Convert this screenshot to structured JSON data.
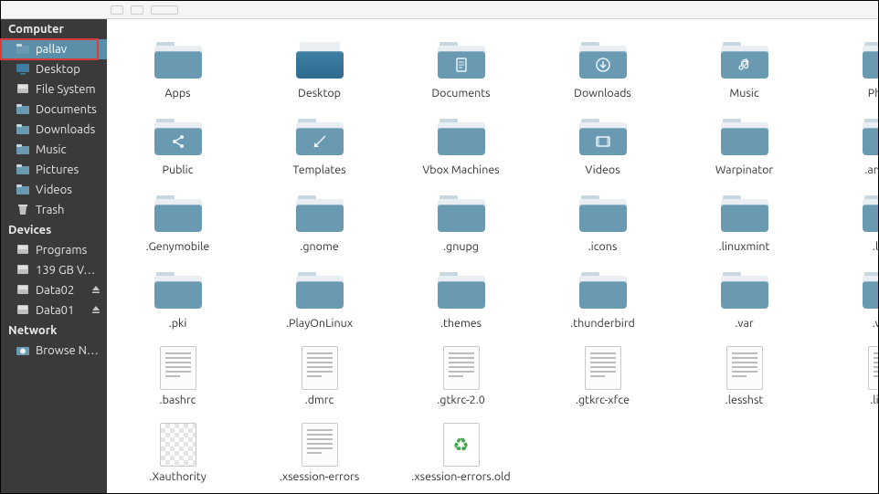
{
  "sidebar": {
    "sections": [
      {
        "title": "Computer",
        "items": [
          {
            "label": "pallav",
            "icon": "home",
            "active": true
          },
          {
            "label": "Desktop",
            "icon": "desktop",
            "active": false
          },
          {
            "label": "File System",
            "icon": "disk",
            "active": false
          },
          {
            "label": "Documents",
            "icon": "folder",
            "active": false
          },
          {
            "label": "Downloads",
            "icon": "folder",
            "active": false
          },
          {
            "label": "Music",
            "icon": "folder",
            "active": false
          },
          {
            "label": "Pictures",
            "icon": "folder",
            "active": false
          },
          {
            "label": "Videos",
            "icon": "folder",
            "active": false
          },
          {
            "label": "Trash",
            "icon": "trash",
            "active": false
          }
        ]
      },
      {
        "title": "Devices",
        "items": [
          {
            "label": "Programs",
            "icon": "disk",
            "eject": false
          },
          {
            "label": "139 GB V…",
            "icon": "disk",
            "eject": false
          },
          {
            "label": "Data02",
            "icon": "disk",
            "eject": true
          },
          {
            "label": "Data01",
            "icon": "disk",
            "eject": true
          }
        ]
      },
      {
        "title": "Network",
        "items": [
          {
            "label": "Browse N…",
            "icon": "network",
            "eject": false
          }
        ]
      }
    ]
  },
  "grid": {
    "items": [
      {
        "label": "Apps",
        "type": "folder",
        "glyph": ""
      },
      {
        "label": "Desktop",
        "type": "folder-desktop",
        "glyph": ""
      },
      {
        "label": "Documents",
        "type": "folder",
        "glyph": "doc"
      },
      {
        "label": "Downloads",
        "type": "folder",
        "glyph": "down"
      },
      {
        "label": "Music",
        "type": "folder",
        "glyph": "music"
      },
      {
        "label": "Photos",
        "type": "folder",
        "glyph": "photo"
      },
      {
        "label": "Public",
        "type": "folder",
        "glyph": "share"
      },
      {
        "label": "Templates",
        "type": "folder",
        "glyph": "template"
      },
      {
        "label": "Vbox Machines",
        "type": "folder",
        "glyph": ""
      },
      {
        "label": "Videos",
        "type": "folder",
        "glyph": "video"
      },
      {
        "label": "Warpinator",
        "type": "folder",
        "glyph": ""
      },
      {
        "label": ".android",
        "type": "folder",
        "glyph": ""
      },
      {
        "label": ".Genymobile",
        "type": "folder",
        "glyph": ""
      },
      {
        "label": ".gnome",
        "type": "folder",
        "glyph": ""
      },
      {
        "label": ".gnupg",
        "type": "folder",
        "glyph": ""
      },
      {
        "label": ".icons",
        "type": "folder",
        "glyph": ""
      },
      {
        "label": ".linuxmint",
        "type": "folder",
        "glyph": ""
      },
      {
        "label": ".local",
        "type": "folder",
        "glyph": ""
      },
      {
        "label": ".pki",
        "type": "folder",
        "glyph": ""
      },
      {
        "label": ".PlayOnLinux",
        "type": "folder",
        "glyph": ""
      },
      {
        "label": ".themes",
        "type": "folder",
        "glyph": ""
      },
      {
        "label": ".thunderbird",
        "type": "folder",
        "glyph": ""
      },
      {
        "label": ".var",
        "type": "folder",
        "glyph": ""
      },
      {
        "label": ".wine",
        "type": "folder",
        "glyph": ""
      },
      {
        "label": ".bashrc",
        "type": "textfile"
      },
      {
        "label": ".dmrc",
        "type": "textfile"
      },
      {
        "label": ".gtkrc-2.0",
        "type": "textfile"
      },
      {
        "label": ".gtkrc-xfce",
        "type": "textfile"
      },
      {
        "label": ".lesshst",
        "type": "textfile"
      },
      {
        "label": ".linssh",
        "type": "textfile"
      },
      {
        "label": ".Xauthority",
        "type": "checkerfile"
      },
      {
        "label": ".xsession-errors",
        "type": "textfile"
      },
      {
        "label": ".xsession-errors.old",
        "type": "recyclefile"
      }
    ]
  }
}
